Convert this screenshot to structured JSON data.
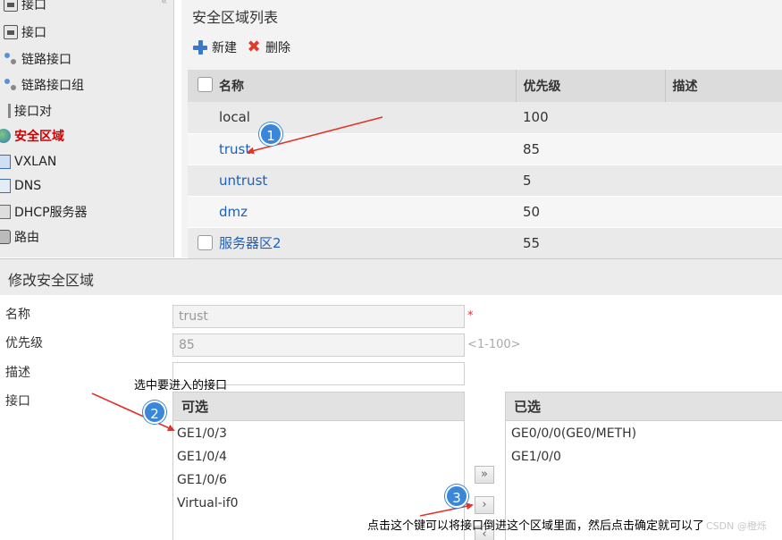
{
  "sidebar": {
    "items": [
      {
        "label": "接口",
        "icon": "interface-icon"
      },
      {
        "label": "接口",
        "icon": "interface-icon"
      },
      {
        "label": "链路接口",
        "icon": "link-interface-icon"
      },
      {
        "label": "链路接口组",
        "icon": "link-interface-group-icon"
      },
      {
        "label": "接口对",
        "icon": "interface-pair-icon"
      },
      {
        "label": "安全区域",
        "icon": "security-zone-icon",
        "active": true
      },
      {
        "label": "VXLAN",
        "icon": "vxlan-icon"
      },
      {
        "label": "DNS",
        "icon": "dns-icon"
      },
      {
        "label": "DHCP服务器",
        "icon": "dhcp-server-icon"
      },
      {
        "label": "路由",
        "icon": "route-icon"
      }
    ]
  },
  "zone_list": {
    "title": "安全区域列表",
    "toolbar": {
      "new_label": "新建",
      "delete_label": "删除"
    },
    "columns": {
      "name": "名称",
      "priority": "优先级",
      "description": "描述"
    },
    "rows": [
      {
        "name": "local",
        "priority": "100",
        "link": false,
        "checkbox": false
      },
      {
        "name": "trust",
        "priority": "85",
        "link": true,
        "checkbox": false
      },
      {
        "name": "untrust",
        "priority": "5",
        "link": true,
        "checkbox": false
      },
      {
        "name": "dmz",
        "priority": "50",
        "link": true,
        "checkbox": false
      },
      {
        "name": "服务器区2",
        "priority": "55",
        "link": true,
        "checkbox": true
      }
    ]
  },
  "edit_zone": {
    "title": "修改安全区域",
    "labels": {
      "name": "名称",
      "priority": "优先级",
      "description": "描述",
      "interface": "接口"
    },
    "values": {
      "name": "trust",
      "priority": "85",
      "description": ""
    },
    "required_mark": "*",
    "priority_hint": "<1-100>",
    "available": {
      "header": "可选",
      "items": [
        "GE1/0/3",
        "GE1/0/4",
        "GE1/0/6",
        "Virtual-if0"
      ]
    },
    "selected": {
      "header": "已选",
      "items": [
        "GE0/0/0(GE0/METH)",
        "GE1/0/0"
      ]
    },
    "buttons": {
      "move_all": "»",
      "move_one": "›",
      "remove_one": "‹"
    }
  },
  "annotations": {
    "badge1": "1",
    "badge2": "2",
    "badge3": "3",
    "text2": "选中要进入的接口",
    "text3": "点击这个键可以将接口倒进这个区域里面，然后点击确定就可以了",
    "arrow_color": "#e0342a",
    "badge_color": "#3a86d8"
  },
  "watermark": "CSDN @橙烁"
}
